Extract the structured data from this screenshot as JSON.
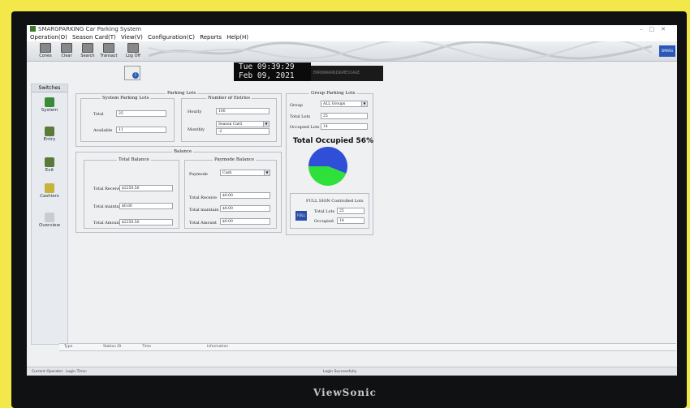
{
  "window": {
    "title": "SMARGPARKING Car Parking System",
    "controls": [
      "–",
      "□",
      "✕"
    ]
  },
  "menu": [
    "Operation(O)",
    "Season Card(T)",
    "View(V)",
    "Configuration(C)",
    "Reports",
    "Help(H)"
  ],
  "toolbar": {
    "buttons": [
      "Cones",
      "Clear",
      "Search",
      "Transact",
      "Log Off"
    ]
  },
  "header": {
    "clock_time": "Tue 09:39:29",
    "clock_date": "Feb 09, 2021",
    "message": "ERRORWARNINGMESSAGE"
  },
  "sidebar": {
    "header": "Switches",
    "items": [
      "System",
      "Entry",
      "Exit",
      "Cashiers",
      "Overview"
    ]
  },
  "parking_lots": {
    "title": "Parking Lots",
    "system": {
      "title": "System Parking Lots",
      "total_label": "Total",
      "total": "25",
      "available_label": "Available",
      "available": "11"
    },
    "entries": {
      "title": "Number of Entries",
      "hourly_label": "Hourly",
      "hourly": "100",
      "card_type": "Season Card",
      "monthly_label": "Monthly",
      "monthly": "-2"
    }
  },
  "balance": {
    "title": "Balance",
    "total": {
      "title": "Total Balance",
      "receive_label": "Total Receive",
      "receive": "$2250.50",
      "maintain_label": "Total maintain",
      "maintain": "$0.00",
      "amount_label": "Total Amount",
      "amount": "$2250.50"
    },
    "paymode": {
      "title": "Paymode Balance",
      "paymode_label": "Paymode",
      "paymode": "Cash",
      "receive_label": "Total Receive",
      "receive": "$0.00",
      "maintain_label": "Total maintain",
      "maintain": "$0.00",
      "amount_label": "Total Amount",
      "amount": "$0.00"
    }
  },
  "group_lots": {
    "title": "Group Parking Lots",
    "group_label": "Group",
    "group": "ALL Groups",
    "total_label": "Total Lots",
    "total": "25",
    "occupied_label": "Occupied Lots",
    "occupied": "14",
    "chart_title": "Total Occupied 56%",
    "full_sign": {
      "title": "FULL SIGN Controlled Lots",
      "total_label": "Total Lots",
      "total": "25",
      "occupied_label": "Occupied",
      "occupied": "14"
    }
  },
  "table": {
    "columns": [
      "Type",
      "Station ID",
      "Time",
      "Information"
    ]
  },
  "status": {
    "operator_label": "Current Operator",
    "login_label": "Login Time:",
    "message": "Login Successfully"
  },
  "monitor_brand": "ViewSonic",
  "colors": {
    "pie_occupied": "#2f4fd8",
    "pie_available": "#2fe03a"
  },
  "chart_data": {
    "type": "pie",
    "title": "Total Occupied 56%",
    "labels": [],
    "values": [
      56,
      44
    ]
  }
}
